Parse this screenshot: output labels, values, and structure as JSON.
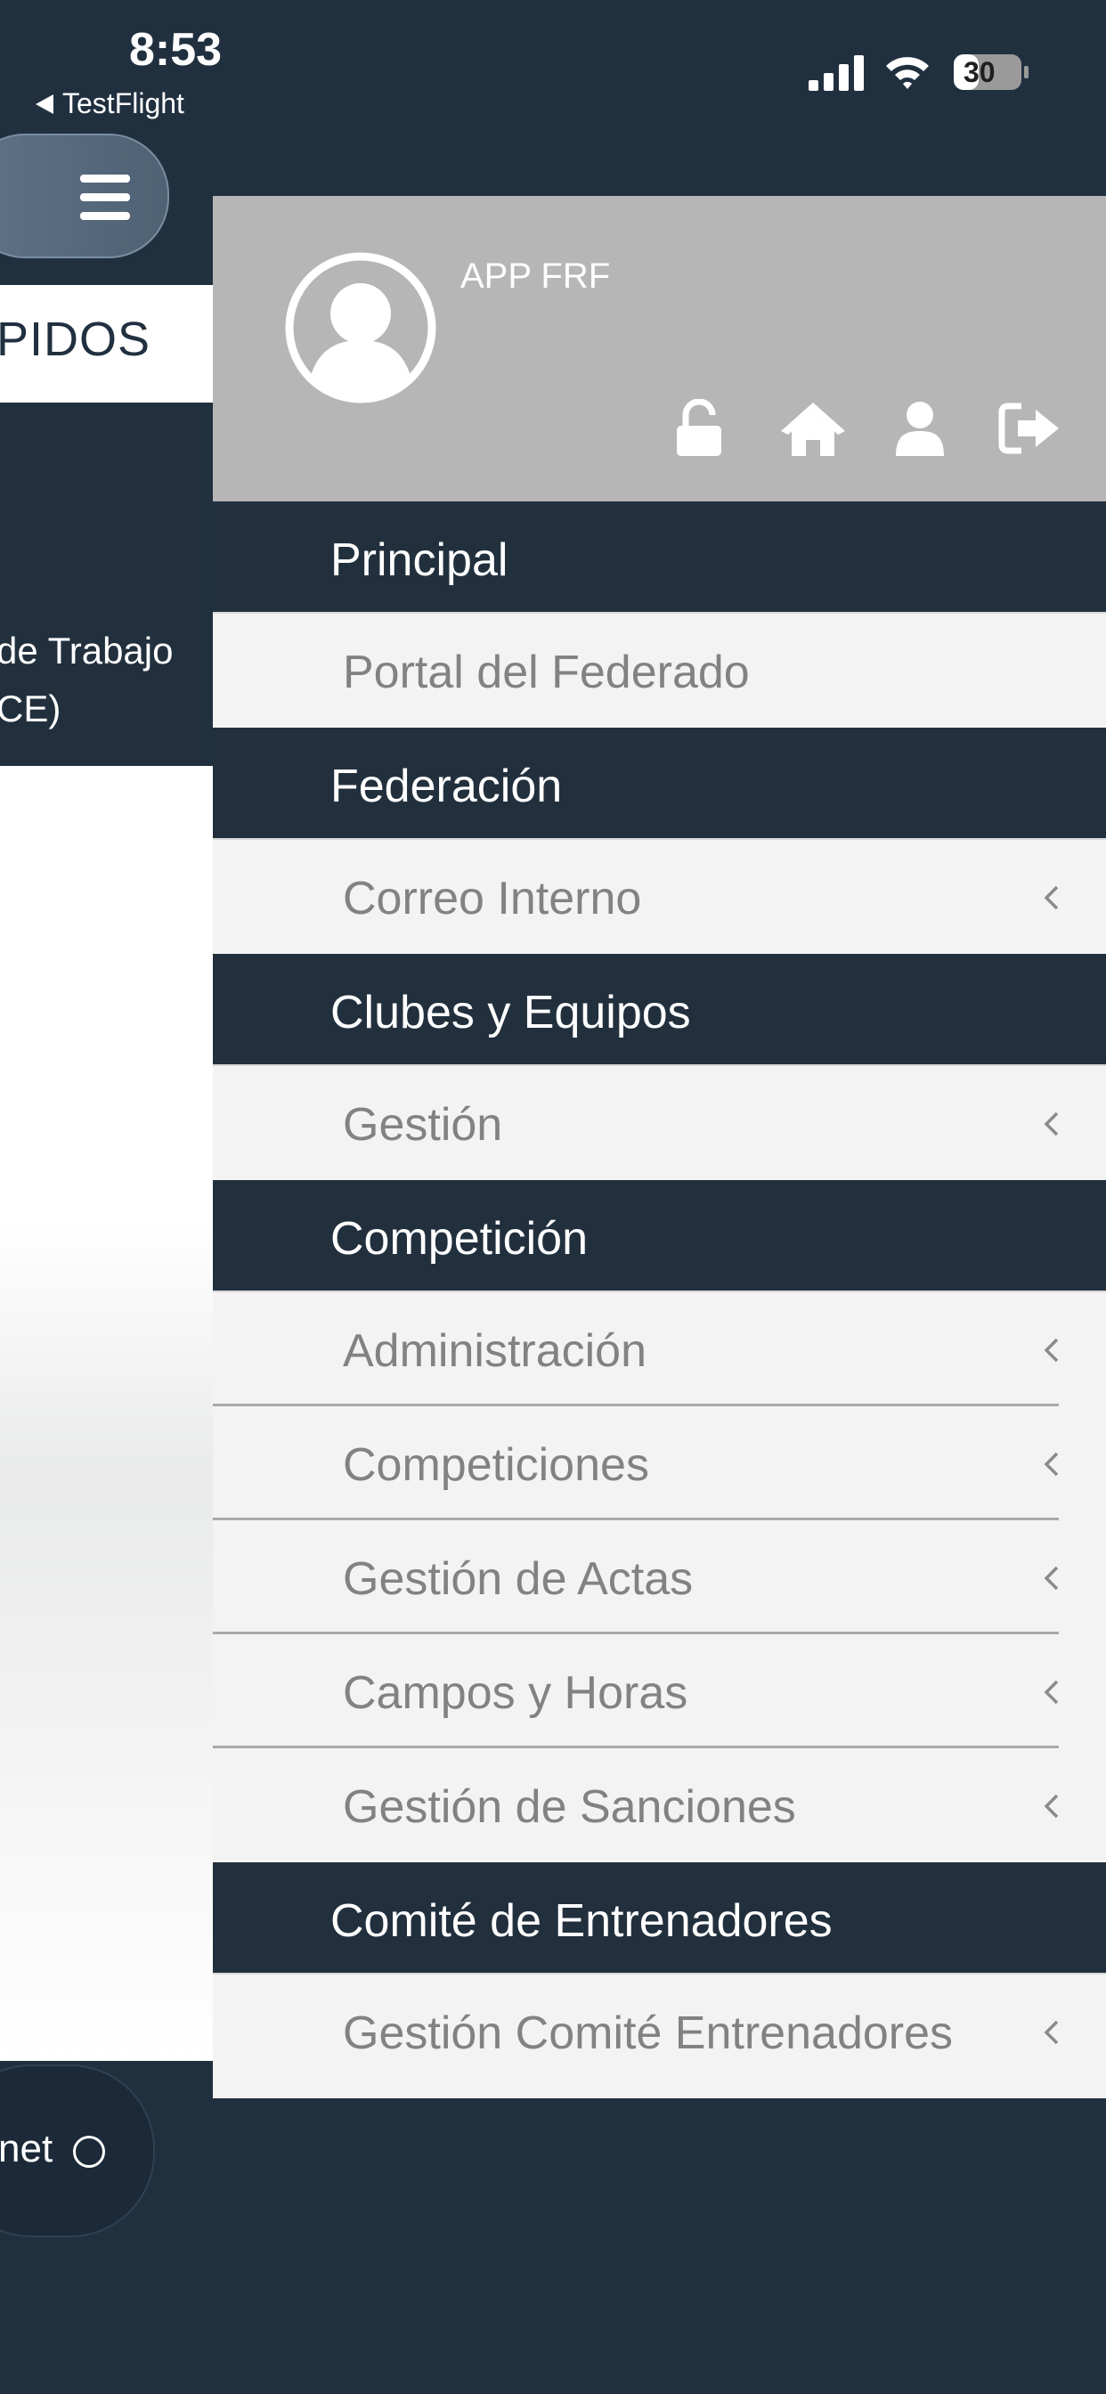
{
  "status_bar": {
    "time": "8:53",
    "back_label": "TestFlight",
    "battery": "30"
  },
  "background_page": {
    "section_title": "PIDOS",
    "card_line_1": "de Trabajo",
    "card_line_2": "CE)",
    "bottom_button": "net"
  },
  "drawer": {
    "app_name": "APP FRF",
    "header_icons": [
      "unlock-icon",
      "home-icon",
      "user-icon",
      "logout-icon"
    ],
    "menu": [
      {
        "type": "section",
        "label": "Principal"
      },
      {
        "type": "item",
        "label": "Portal del Federado",
        "chevron": false
      },
      {
        "type": "section",
        "label": "Federación"
      },
      {
        "type": "item",
        "label": "Correo Interno",
        "chevron": true
      },
      {
        "type": "section",
        "label": "Clubes y Equipos"
      },
      {
        "type": "item",
        "label": "Gestión",
        "chevron": true
      },
      {
        "type": "section",
        "label": "Competición"
      },
      {
        "type": "item",
        "label": "Administración",
        "chevron": true
      },
      {
        "type": "item",
        "label": "Competiciones",
        "chevron": true
      },
      {
        "type": "item",
        "label": "Gestión de Actas",
        "chevron": true
      },
      {
        "type": "item",
        "label": "Campos y Horas",
        "chevron": true
      },
      {
        "type": "item",
        "label": "Gestión de Sanciones",
        "chevron": true
      },
      {
        "type": "section",
        "label": "Comité de Entrenadores"
      },
      {
        "type": "item",
        "label": "Gestión Comité Entrenadores",
        "chevron": true
      }
    ]
  },
  "colors": {
    "navy": "#22303e",
    "header_gray": "#b6b6b6",
    "item_bg": "#f3f3f3",
    "item_text": "#828282"
  }
}
